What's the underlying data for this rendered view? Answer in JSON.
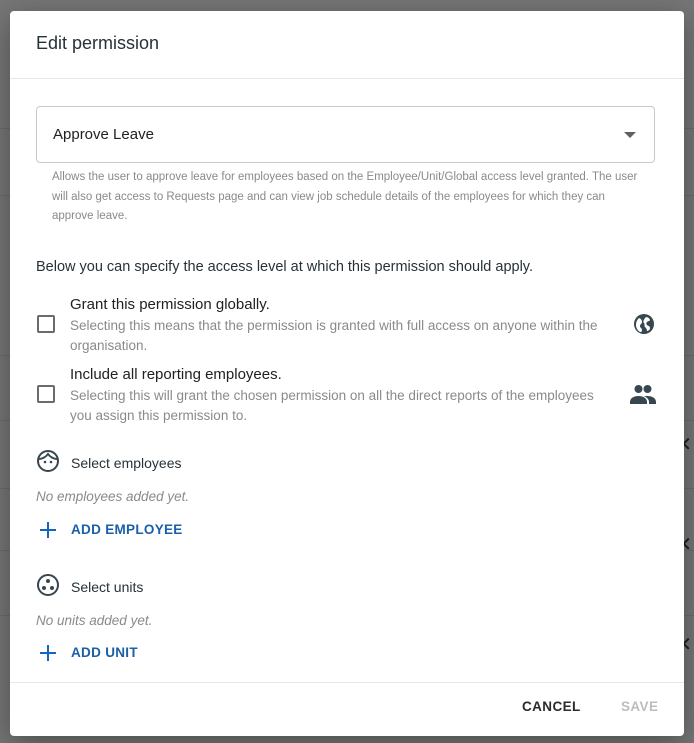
{
  "dialog": {
    "title": "Edit permission",
    "permission_select": {
      "value": "Approve Leave",
      "helper_text": "Allows the user to approve leave for employees based on the Employee/Unit/Global access level granted. The user will also get access to Requests page and can view job schedule details of the employees for which they can approve leave."
    },
    "lead_text": "Below you can specify the access level at which this permission should apply.",
    "options": [
      {
        "title": "Grant this permission globally.",
        "description": "Selecting this means that the permission is granted with full access on anyone within the organisation.",
        "checked": false,
        "icon": "globe-icon"
      },
      {
        "title": "Include all reporting employees.",
        "description": "Selecting this will grant the chosen permission on all the direct reports of the employees you assign this permission to.",
        "checked": false,
        "icon": "people-icon"
      }
    ],
    "employees": {
      "title": "Select employees",
      "empty_text": "No employees added yet.",
      "add_label": "ADD EMPLOYEE",
      "icon": "face-icon"
    },
    "units": {
      "title": "Select units",
      "empty_text": "No units added yet.",
      "add_label": "ADD UNIT",
      "icon": "unit-icon"
    },
    "actions": {
      "cancel_label": "CANCEL",
      "save_label": "SAVE",
      "save_disabled": true
    }
  },
  "colors": {
    "accent": "#1a5fa8",
    "title_text": "#263238",
    "secondary_text": "#8a8a8a",
    "disabled_text": "#bdbdbd",
    "backdrop": "rgba(0,0,0,0.45)"
  }
}
